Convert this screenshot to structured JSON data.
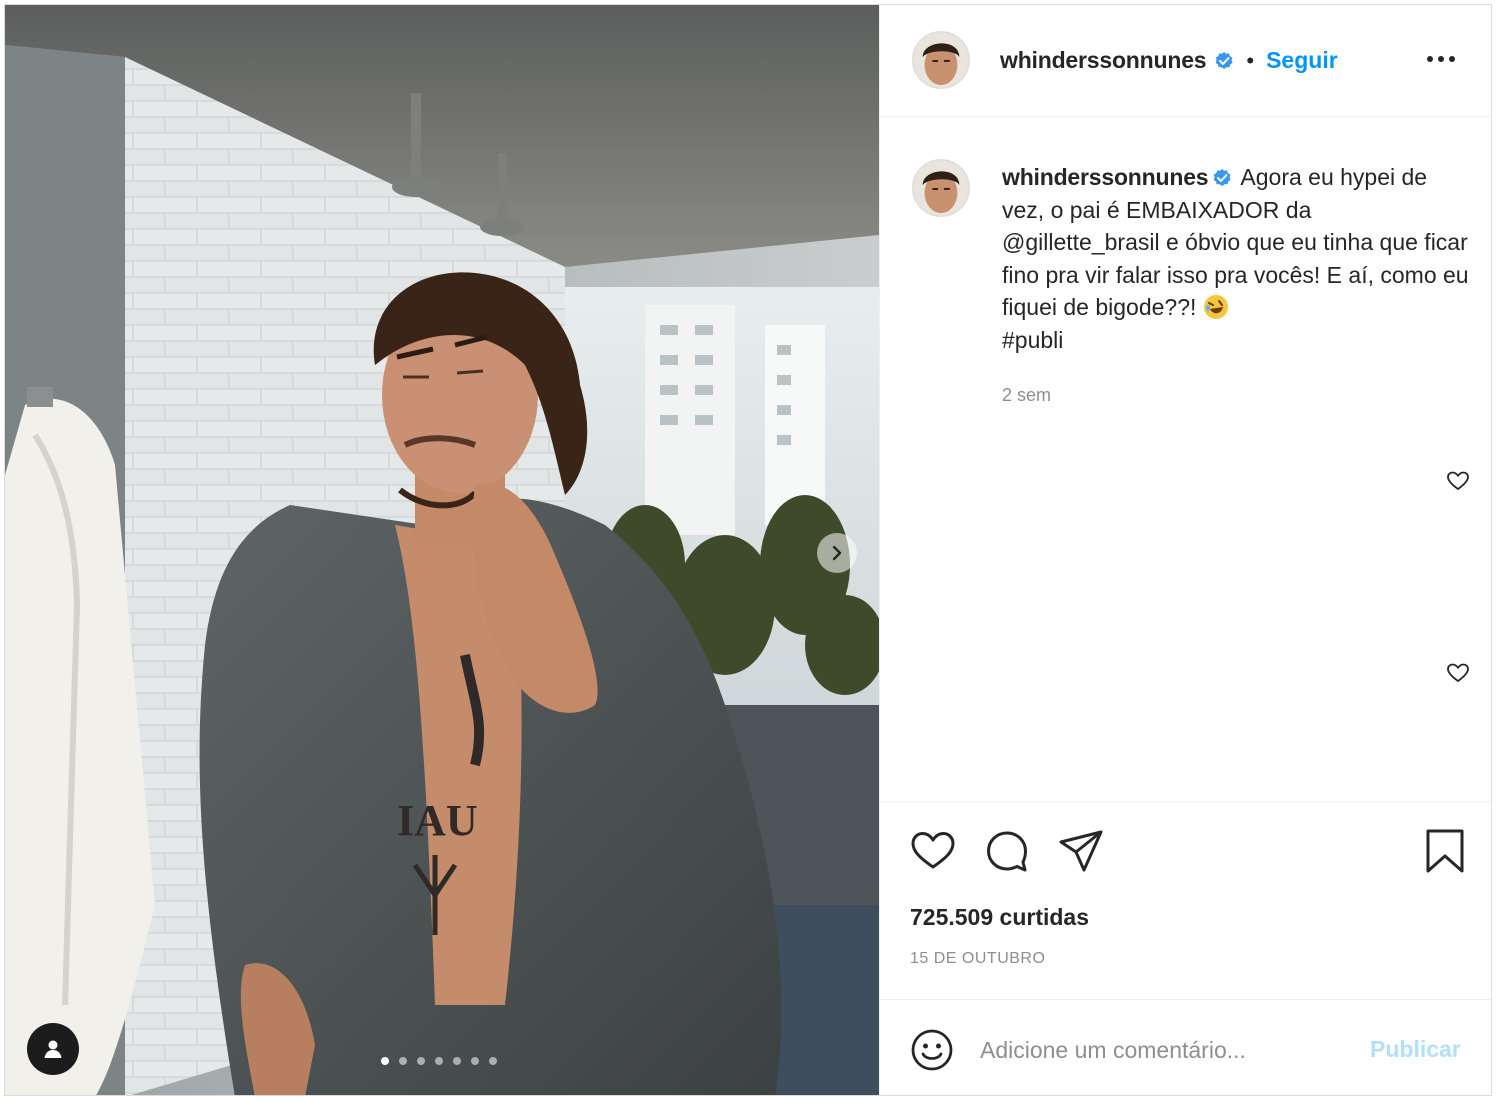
{
  "post": {
    "username": "whinderssonnunes",
    "separator": "•",
    "follow_label": "Seguir",
    "verified_icon": "verified-badge-icon",
    "more_icon": "more-options-icon"
  },
  "media": {
    "carousel_total": 7,
    "carousel_active_index": 0,
    "next_icon": "chevron-right-icon",
    "tag_icon": "user-tag-icon"
  },
  "caption": {
    "username": "whinderssonnunes",
    "text": "Agora eu hypei de vez, o pai é EMBAIXADOR da @gillette_brasil e óbvio que eu tinha que ficar fino pra vir falar isso pra vocês! E aí, como eu fiquei de bigode??! ",
    "emoji_icon": "rolling-on-floor-laughing-emoji",
    "hashtag": "#publi",
    "time_ago": "2 sem"
  },
  "actions": {
    "like_icon": "heart-icon",
    "comment_icon": "comment-icon",
    "share_icon": "share-icon",
    "save_icon": "bookmark-icon"
  },
  "stats": {
    "likes": "725.509 curtidas",
    "date": "15 DE OUTUBRO"
  },
  "comment_box": {
    "placeholder": "Adicione um comentário...",
    "submit_label": "Publicar",
    "emoji_icon": "smiley-icon"
  },
  "colors": {
    "link_blue": "#0095f6",
    "publish_disabled": "#b2dffc",
    "text": "#262626",
    "muted": "#8e8e8e"
  }
}
